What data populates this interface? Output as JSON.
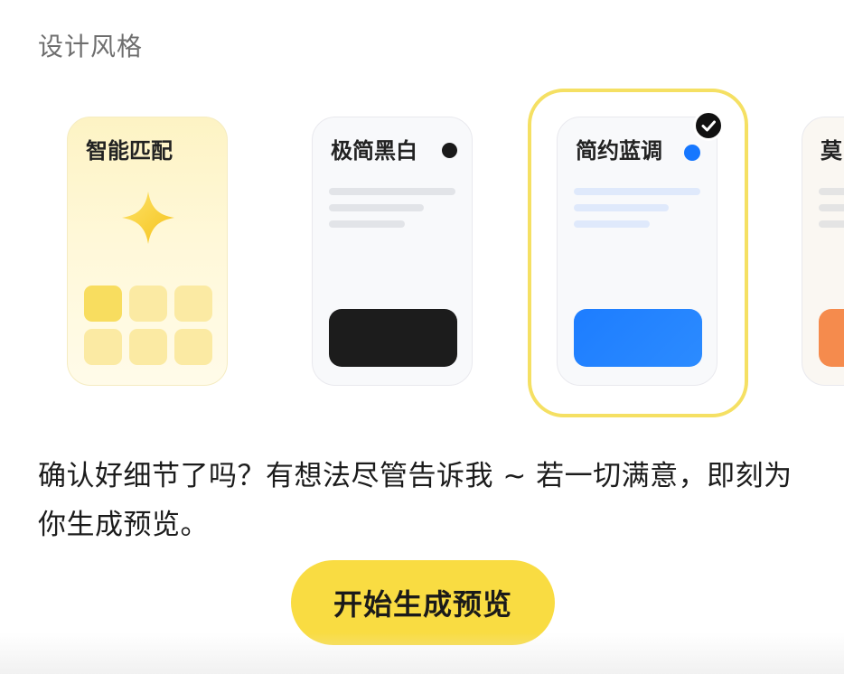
{
  "section": {
    "title": "设计风格"
  },
  "styles": [
    {
      "id": "smart",
      "label": "智能匹配",
      "icon": "sparkle-icon",
      "selected": false,
      "colors": {
        "accent": "#f8dd5f",
        "cell": "#fbeaa3",
        "sparkle": "#f8cf2c"
      }
    },
    {
      "id": "minimal-bw",
      "label": "极简黑白",
      "selected": false,
      "colors": {
        "dot": "#1a1a1a",
        "block": "#1c1c1c",
        "line": "#e2e4e8"
      }
    },
    {
      "id": "simple-blue",
      "label": "简约蓝调",
      "selected": true,
      "colors": {
        "dot": "#1677ff",
        "block": "#1677ff",
        "line": "#dfe9fb"
      }
    },
    {
      "id": "warm",
      "label": "莫",
      "selected": false,
      "colors": {
        "block": "#f58b4d",
        "line": "#e4e4e4"
      }
    }
  ],
  "message": "确认好细节了吗？有想法尽管告诉我 ~ 若一切满意，即刻为你生成预览。",
  "cta": {
    "label": "开始生成预览",
    "color": "#f9dc42"
  },
  "selection_color": "#f5e063"
}
